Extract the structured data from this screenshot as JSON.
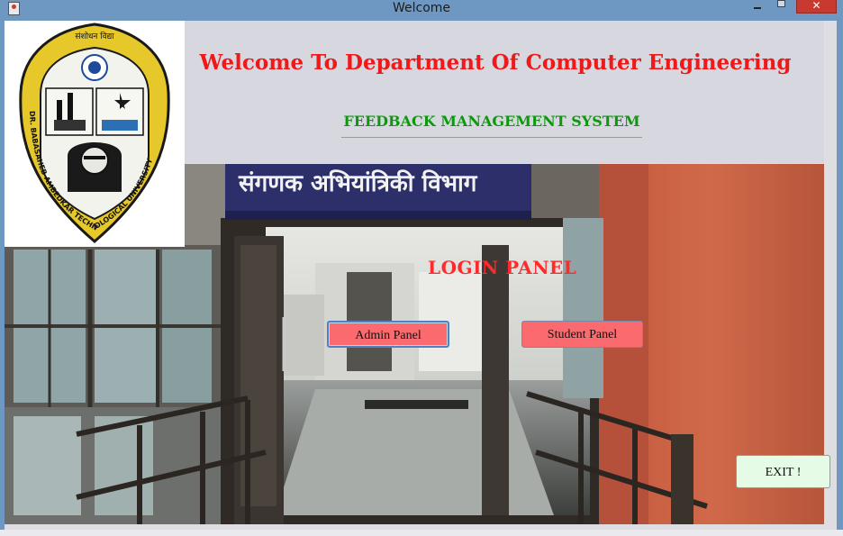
{
  "window": {
    "title": "Welcome",
    "close_glyph": "✕",
    "icons": [
      "java-icon",
      "minimize-icon",
      "maximize-icon",
      "close-icon"
    ]
  },
  "header": {
    "heading": "Welcome To Department Of Computer Engineering",
    "subheading": "FEEDBACK MANAGEMENT SYSTEM"
  },
  "logo": {
    "top_text": "संशोधन विद्या",
    "ring_text": "DR. BABASAHEB AMBEDKAR TECHNOLOGICAL UNIVERSITY"
  },
  "photo": {
    "signboard_text": "संगणक अभियांत्रिकी विभाग"
  },
  "login": {
    "title": "LOGIN  PANEL",
    "admin_label": "Admin Panel",
    "student_label": "Student Panel",
    "exit_label": "EXIT !"
  },
  "colors": {
    "heading": "#f01818",
    "subheading": "#0a9a0a",
    "login_title": "#ff2a2a",
    "panel_button": "#fb6a6e",
    "exit_button": "#e6fbe6",
    "titlebar": "#6e98c2"
  }
}
